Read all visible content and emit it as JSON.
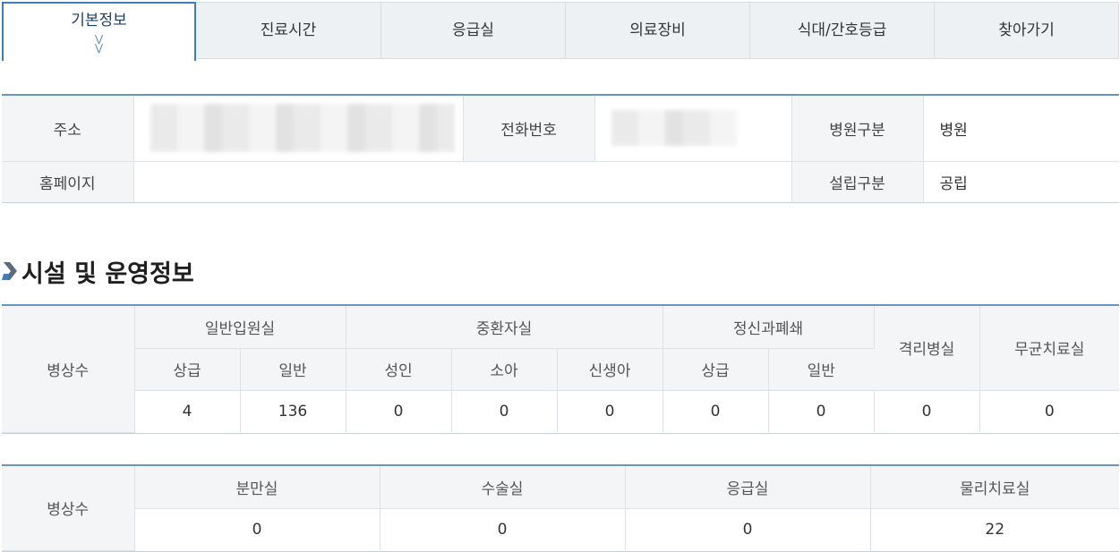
{
  "tabs": [
    {
      "label": "기본정보",
      "active": true
    },
    {
      "label": "진료시간",
      "active": false
    },
    {
      "label": "응급실",
      "active": false
    },
    {
      "label": "의료장비",
      "active": false
    },
    {
      "label": "식대/간호등급",
      "active": false
    },
    {
      "label": "찾아가기",
      "active": false
    }
  ],
  "basic_info": {
    "address_label": "주소",
    "phone_label": "전화번호",
    "hospital_type_label": "병원구분",
    "hospital_type_value": "병원",
    "homepage_label": "홈페이지",
    "homepage_value": "",
    "establishment_label": "설립구분",
    "establishment_value": "공립"
  },
  "section_title": "시설 및 운영정보",
  "beds_table": {
    "row_label": "병상수",
    "groups": {
      "general_ward": "일반입원실",
      "intensive_care": "중환자실",
      "psychiatric_closed": "정신과폐쇄",
      "isolation": "격리병실",
      "sterile": "무균치료실"
    },
    "sub": {
      "upper": "상급",
      "general": "일반",
      "adult": "성인",
      "child": "소아",
      "newborn": "신생아",
      "psy_upper": "상급",
      "psy_general": "일반"
    },
    "values": {
      "general_upper": "4",
      "general_general": "136",
      "icu_adult": "0",
      "icu_child": "0",
      "icu_newborn": "0",
      "psy_upper": "0",
      "psy_general": "0",
      "isolation": "0",
      "sterile": "0"
    }
  },
  "rooms_table": {
    "row_label": "병상수",
    "headers": [
      "분만실",
      "수술실",
      "응급실",
      "물리치료실"
    ],
    "values": [
      "0",
      "0",
      "0",
      "22"
    ]
  },
  "colors": {
    "accent": "#3f7fb5",
    "header_bg": "#f4f5f7",
    "tab_bg": "#eef1f4"
  }
}
